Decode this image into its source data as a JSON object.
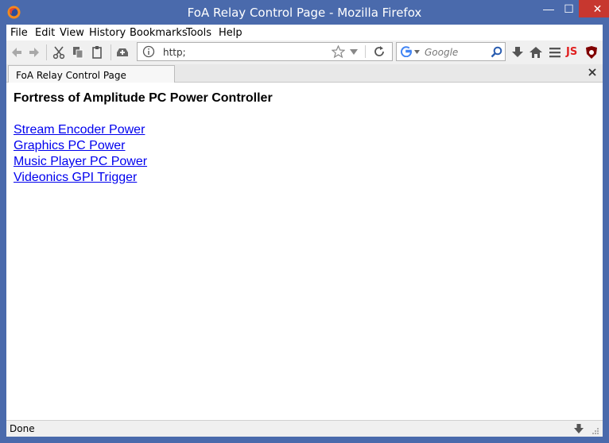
{
  "window": {
    "title": "FoA Relay Control Page - Mozilla Firefox",
    "controls": {
      "minimize": "—",
      "maximize": "☐",
      "close": "✕"
    }
  },
  "menu": {
    "items": [
      {
        "label": "File"
      },
      {
        "label": "Edit"
      },
      {
        "label": "View"
      },
      {
        "label": "History"
      },
      {
        "label": "Bookmarks"
      },
      {
        "label": "Tools"
      },
      {
        "label": "Help"
      }
    ]
  },
  "navbar": {
    "url": "http;",
    "search_placeholder": "Google",
    "js_badge": "JS",
    "icons": [
      "back-icon",
      "forward-icon",
      "cut-icon",
      "copy-icon",
      "paste-icon",
      "upload-icon",
      "info-icon",
      "bookmark-star-icon",
      "dropdown-icon",
      "reload-icon",
      "google-icon",
      "search-icon",
      "download-icon",
      "home-icon",
      "menu-icon",
      "js-icon",
      "ublock-icon"
    ]
  },
  "tabs": [
    {
      "label": "FoA Relay Control Page"
    }
  ],
  "page": {
    "heading": "Fortress of Amplitude PC Power Controller",
    "links": [
      {
        "label": "Stream Encoder Power"
      },
      {
        "label": "Graphics PC Power"
      },
      {
        "label": "Music Player PC Power"
      },
      {
        "label": "Videonics GPI Trigger"
      }
    ]
  },
  "status": {
    "text": "Done"
  },
  "colors": {
    "frame": "#4a6aac",
    "close": "#c7372f",
    "link": "#0000ee"
  }
}
